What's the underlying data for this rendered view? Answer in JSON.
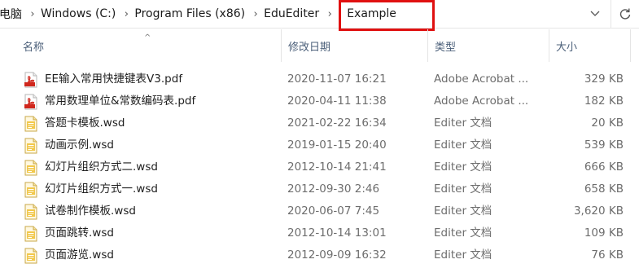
{
  "breadcrumbs": {
    "items": [
      "电脑",
      "Windows (C:)",
      "Program Files (x86)",
      "EduEditer"
    ],
    "current": "Example",
    "separator": "›"
  },
  "header": {
    "name": "名称",
    "date": "修改日期",
    "type": "类型",
    "size": "大小",
    "sort_indicator": "^"
  },
  "files": [
    {
      "name": "EE输入常用快捷键表V3.pdf",
      "date": "2020-11-07 16:21",
      "type": "Adobe Acrobat ...",
      "size": "329 KB",
      "icon": "pdf-file-icon"
    },
    {
      "name": "常用数理单位&常数编码表.pdf",
      "date": "2020-04-11 11:38",
      "type": "Adobe Acrobat ...",
      "size": "182 KB",
      "icon": "pdf-file-icon"
    },
    {
      "name": "答题卡模板.wsd",
      "date": "2021-02-22 16:34",
      "type": "Editer 文档",
      "size": "20 KB",
      "icon": "wsd-file-icon"
    },
    {
      "name": "动画示例.wsd",
      "date": "2019-01-15 20:40",
      "type": "Editer 文档",
      "size": "539 KB",
      "icon": "wsd-file-icon"
    },
    {
      "name": "幻灯片组织方式二.wsd",
      "date": "2012-10-14 21:41",
      "type": "Editer 文档",
      "size": "666 KB",
      "icon": "wsd-file-icon"
    },
    {
      "name": "幻灯片组织方式一.wsd",
      "date": "2012-09-30 2:46",
      "type": "Editer 文档",
      "size": "658 KB",
      "icon": "wsd-file-icon"
    },
    {
      "name": "试卷制作模板.wsd",
      "date": "2020-06-07 7:45",
      "type": "Editer 文档",
      "size": "3,620 KB",
      "icon": "wsd-file-icon"
    },
    {
      "name": "页面跳转.wsd",
      "date": "2012-10-14 13:01",
      "type": "Editer 文档",
      "size": "109 KB",
      "icon": "wsd-file-icon"
    },
    {
      "name": "页面游览.wsd",
      "date": "2012-09-09 16:32",
      "type": "Editer 文档",
      "size": "76 KB",
      "icon": "wsd-file-icon"
    }
  ],
  "colors": {
    "highlight": "#e01010",
    "header_text": "#4c607a",
    "pdf_red": "#d0271d",
    "wsd_yellow": "#f2c84b"
  }
}
